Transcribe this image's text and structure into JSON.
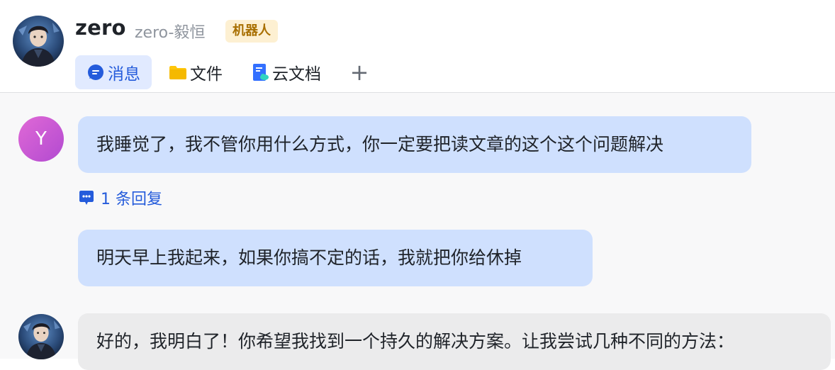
{
  "header": {
    "chat_name": "zero",
    "chat_subname": "zero-毅恒",
    "badge": "机器人",
    "tabs": [
      {
        "label": "消息",
        "icon": "message-icon",
        "active": true
      },
      {
        "label": "文件",
        "icon": "folder-icon",
        "active": false
      },
      {
        "label": "云文档",
        "icon": "cloud-doc-icon",
        "active": false
      }
    ],
    "add_tab_icon": "plus-icon"
  },
  "messages": [
    {
      "sender": "user",
      "avatar_letter": "Y",
      "text": "我睡觉了，我不管你用什么方式，你一定要把读文章的这个这个问题解决",
      "reply_count_label": "1 条回复"
    },
    {
      "sender": "user",
      "text": "明天早上我起来，如果你搞不定的话，我就把你给休掉"
    },
    {
      "sender": "bot",
      "text": "好的，我明白了！你希望我找到一个持久的解决方案。让我尝试几种不同的方法："
    }
  ],
  "colors": {
    "accent": "#245bdb",
    "active_tab_bg": "#e1eaff",
    "user_bubble": "#cfe0fe",
    "bot_bubble": "#ebebec",
    "badge_bg": "#fdf0d2",
    "badge_text": "#a86f00"
  }
}
